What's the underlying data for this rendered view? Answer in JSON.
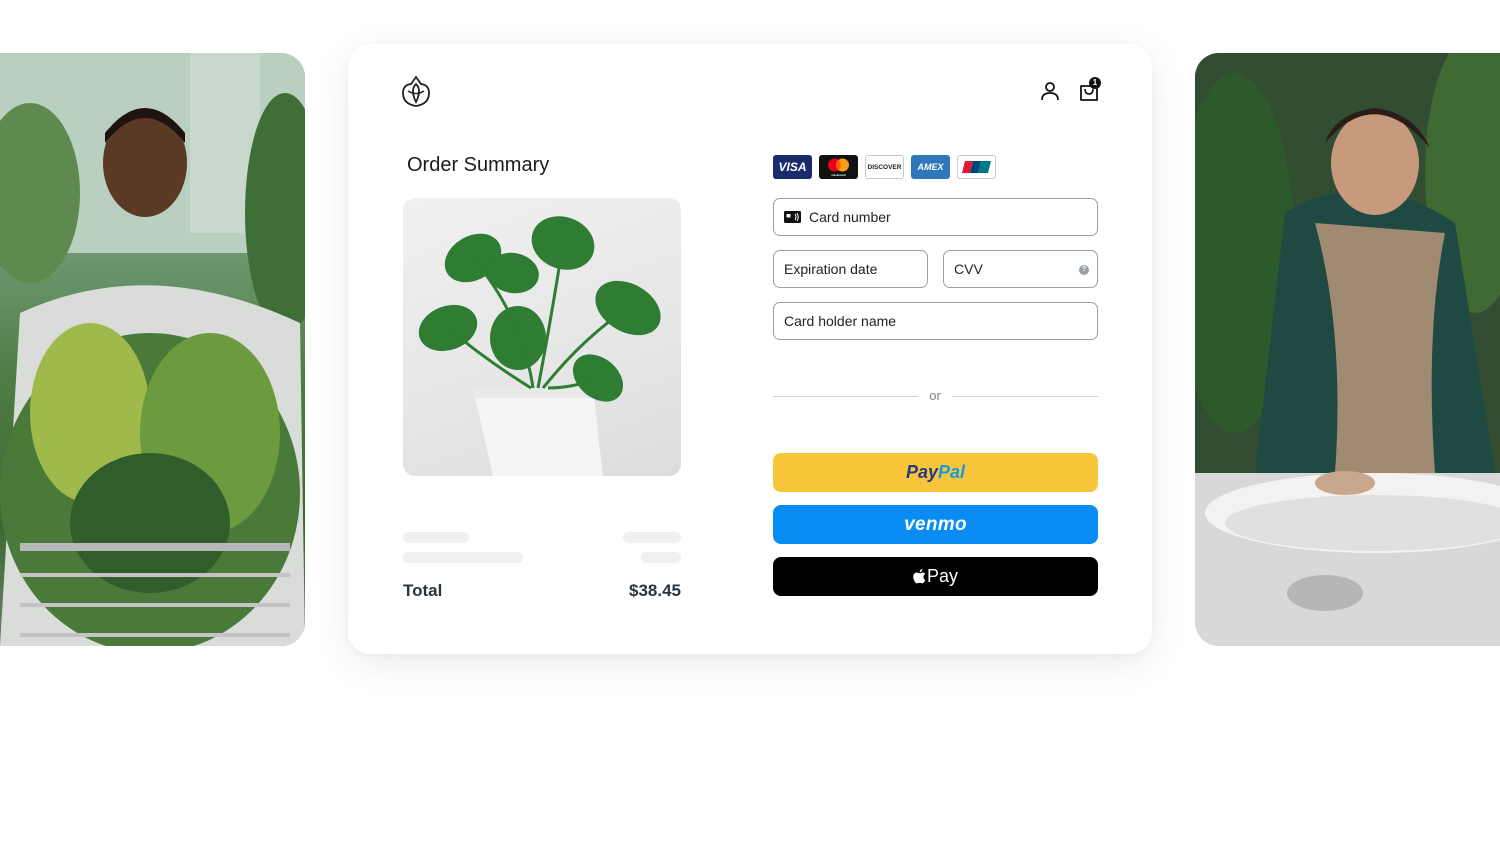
{
  "header": {
    "logo_icon": "tulip-leaf-logo-icon",
    "account_icon": "user-icon",
    "cart_icon": "shopping-bag-icon",
    "cart_count": "1"
  },
  "order_summary": {
    "title": "Order Summary",
    "product_image": "monstera-plant-in-white-pot",
    "total_label": "Total",
    "total_value": "$38.45"
  },
  "payment": {
    "card_brands": [
      "VISA",
      "mastercard",
      "DISCOVER",
      "AMEX",
      "UnionPay"
    ],
    "card_number_placeholder": "Card number",
    "expiration_placeholder": "Expiration date",
    "cvv_placeholder": "CVV",
    "holder_placeholder": "Card holder name",
    "divider_text": "or",
    "paypal": {
      "part1": "Pay",
      "part2": "Pal",
      "color": "#f9c53b"
    },
    "venmo": {
      "label": "venmo",
      "color": "#0a8cf5"
    },
    "applepay": {
      "label": "Pay",
      "color": "#000000"
    }
  },
  "side_photos": {
    "left": "man-holding-cart-of-plants",
    "right": "woman-at-pottery-wheel"
  }
}
